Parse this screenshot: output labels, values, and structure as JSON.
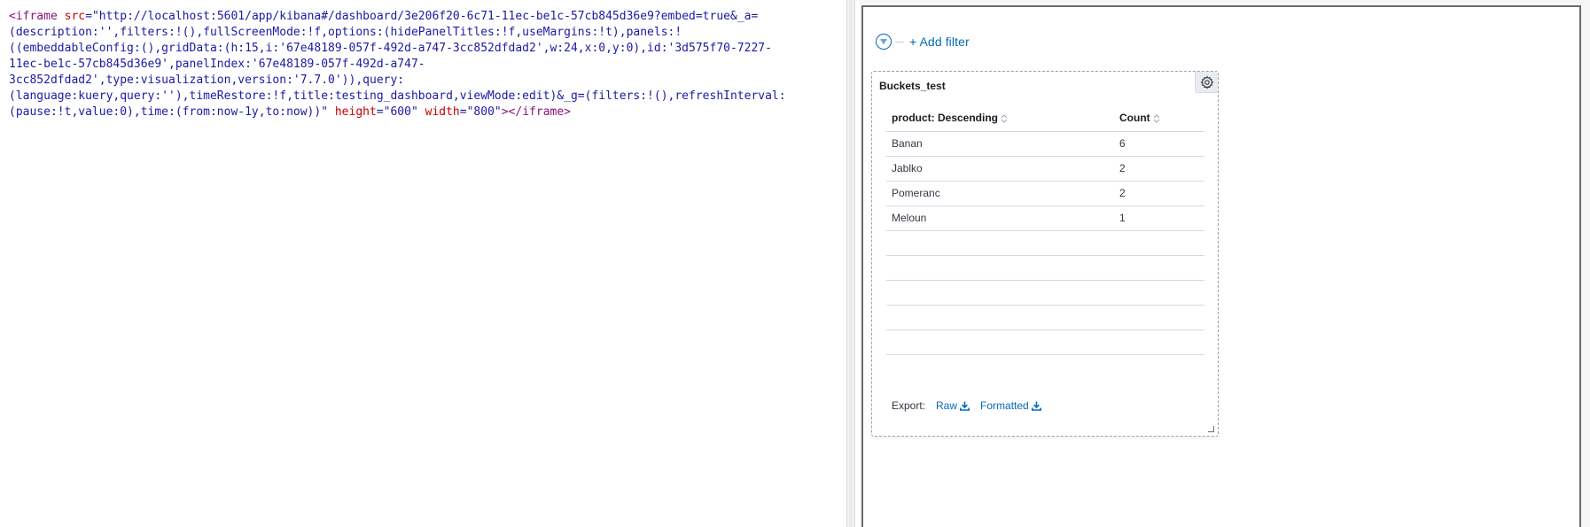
{
  "editor": {
    "lines": [
      {
        "parts": [
          {
            "t": "tag",
            "v": "<iframe "
          },
          {
            "t": "attr",
            "v": "src"
          },
          {
            "t": "val",
            "v": "=\"http://localhost:5601/app/kibana#/dashboard/3e206f20-6c71-11ec-be1c-57cb845d36e9?embed=true&_a="
          }
        ]
      },
      {
        "parts": [
          {
            "t": "val",
            "v": "(description:'',filters:!(),fullScreenMode:!f,options:(hidePanelTitles:!f,useMargins:!t),panels:!"
          }
        ]
      },
      {
        "parts": [
          {
            "t": "val",
            "v": "((embeddableConfig:(),gridData:(h:15,i:'67e48189-057f-492d-a747-3cc852dfdad2',w:24,x:0,y:0),id:'3d575f70-7227-"
          }
        ]
      },
      {
        "parts": [
          {
            "t": "val",
            "v": "11ec-be1c-57cb845d36e9',panelIndex:'67e48189-057f-492d-a747-"
          }
        ]
      },
      {
        "parts": [
          {
            "t": "val",
            "v": "3cc852dfdad2',type:visualization,version:'7.7.0')),query:"
          }
        ]
      },
      {
        "parts": [
          {
            "t": "val",
            "v": "(language:kuery,query:''),timeRestore:!f,title:testing_dashboard,viewMode:edit)&_g=(filters:!(),refreshInterval:"
          }
        ]
      },
      {
        "parts": [
          {
            "t": "val",
            "v": "(pause:!t,value:0),time:(from:now-1y,to:now))\" "
          },
          {
            "t": "attr",
            "v": "height"
          },
          {
            "t": "val",
            "v": "=\"600\" "
          },
          {
            "t": "attr",
            "v": "width"
          },
          {
            "t": "val",
            "v": "=\"800\""
          },
          {
            "t": "tag",
            "v": "></iframe>"
          }
        ]
      }
    ]
  },
  "filter_bar": {
    "icon": "filter-icon",
    "add_filter_label": "+ Add filter"
  },
  "panel": {
    "title": "Buckets_test",
    "options_icon": "gear-icon",
    "table": {
      "columns": [
        "product: Descending",
        "Count"
      ],
      "rows": [
        [
          "Banan",
          "6"
        ],
        [
          "Jablko",
          "2"
        ],
        [
          "Pomeranc",
          "2"
        ],
        [
          "Meloun",
          "1"
        ]
      ],
      "empty_rows": 5
    },
    "export": {
      "label": "Export:",
      "raw_label": "Raw",
      "formatted_label": "Formatted",
      "icon": "download-icon"
    }
  },
  "colors": {
    "link": "#006bb4",
    "tag": "#881280",
    "attr": "#c80000",
    "value": "#1a1aa6",
    "border": "#d3dae6"
  }
}
